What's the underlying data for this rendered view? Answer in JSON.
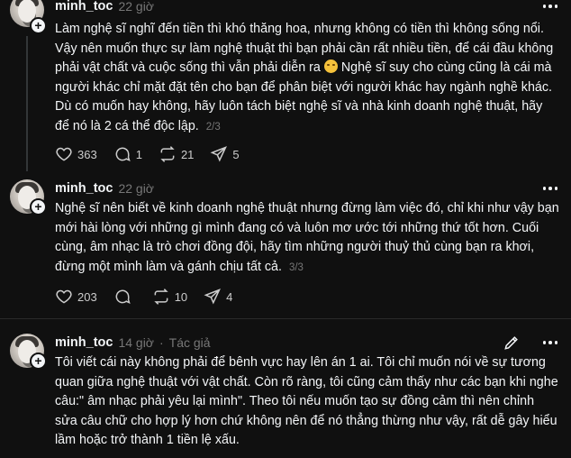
{
  "posts": [
    {
      "username": "minh_toc",
      "time": "22 giờ",
      "body": "Làm nghệ sĩ nghĩ đến tiền thì khó thăng hoa, nhưng không có tiền thì không sống nổi. Vậy nên muốn thực sự làm nghệ thuật thì bạn phải cần rất nhiều tiền, để cái đầu không phải vật chất và cuộc sống thì vẫn phải diễn ra",
      "body_after_emoji": " Nghệ sĩ suy cho cùng cũng là cái mà người khác chỉ mặt đặt tên cho bạn để phân biệt với người khác hay ngành nghề khác. Dù có muốn hay không, hãy luôn tách biệt nghệ sĩ và nhà kinh doanh nghệ thuật, hãy để nó là 2 cá thể độc lập.",
      "emoji": "rolling-on-floor-laughing-emoji",
      "page_count": "2/3",
      "likes": "363",
      "replies": "1",
      "reposts": "21",
      "shares": "5"
    },
    {
      "username": "minh_toc",
      "time": "22 giờ",
      "body": "Nghệ sĩ nên biết về kinh doanh nghệ thuật nhưng đừng làm việc đó, chỉ khi như vậy bạn mới hài lòng với những gì mình đang có và luôn mơ ước tới những thứ tốt hơn. Cuối cùng, âm nhạc là trò chơi đồng đội, hãy tìm những người thuỷ thủ cùng bạn ra khơi, đừng một mình làm và gánh chịu tất cả.",
      "page_count": "3/3",
      "likes": "203",
      "replies": "",
      "reposts": "10",
      "shares": "4"
    },
    {
      "username": "minh_toc",
      "time": "14 giờ",
      "author_tag": "Tác giả",
      "dot": "·",
      "body": "Tôi viết cái này không phải để bênh vực hay lên án 1 ai. Tôi chỉ muốn nói về sự tương quan giữa nghệ thuật với vật chất. Còn rõ ràng, tôi cũng cảm thấy như các bạn khi nghe câu:\" âm nhạc phải yêu lại mình\". Theo tôi nếu muốn tạo sự đồng cảm thì nên chỉnh sửa câu chữ cho hợp lý hơn chứ không nên để nó thẳng thừng như vậy, rất dễ gây hiểu lầm hoặc trở thành 1 tiền lệ xấu."
    }
  ],
  "colors": {
    "background": "#101010",
    "text": "#f3f5f7",
    "muted": "#777777",
    "divider": "#2a2a2a"
  }
}
